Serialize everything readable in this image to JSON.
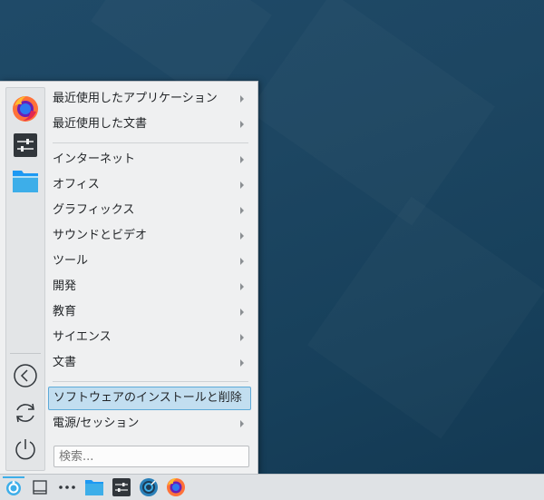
{
  "menu": {
    "items": [
      {
        "label": "最近使用したアプリケーション",
        "submenu": true
      },
      {
        "label": "最近使用した文書",
        "submenu": true
      },
      {
        "label": "インターネット",
        "submenu": true
      },
      {
        "label": "オフィス",
        "submenu": true
      },
      {
        "label": "グラフィックス",
        "submenu": true
      },
      {
        "label": "サウンドとビデオ",
        "submenu": true
      },
      {
        "label": "ツール",
        "submenu": true
      },
      {
        "label": "開発",
        "submenu": true
      },
      {
        "label": "教育",
        "submenu": true
      },
      {
        "label": "サイエンス",
        "submenu": true
      },
      {
        "label": "文書",
        "submenu": true
      },
      {
        "label": "ソフトウェアのインストールと削除",
        "submenu": false,
        "selected": true
      },
      {
        "label": "電源/セッション",
        "submenu": true
      }
    ],
    "search_placeholder": "検索...",
    "favorites": [
      "firefox-icon",
      "system-settings-icon",
      "file-manager-icon"
    ],
    "system_buttons": [
      "logout-icon",
      "switch-user-icon",
      "power-icon"
    ]
  },
  "taskbar": {
    "items": [
      "application-launcher-icon",
      "show-desktop-icon",
      "more-icon",
      "file-manager-icon",
      "system-settings-icon",
      "discover-icon",
      "firefox-icon"
    ]
  },
  "colors": {
    "selection_bg": "#c2def0",
    "selection_border": "#5eaad8",
    "desktop": "#1d4662",
    "panel": "#eff0f1"
  }
}
